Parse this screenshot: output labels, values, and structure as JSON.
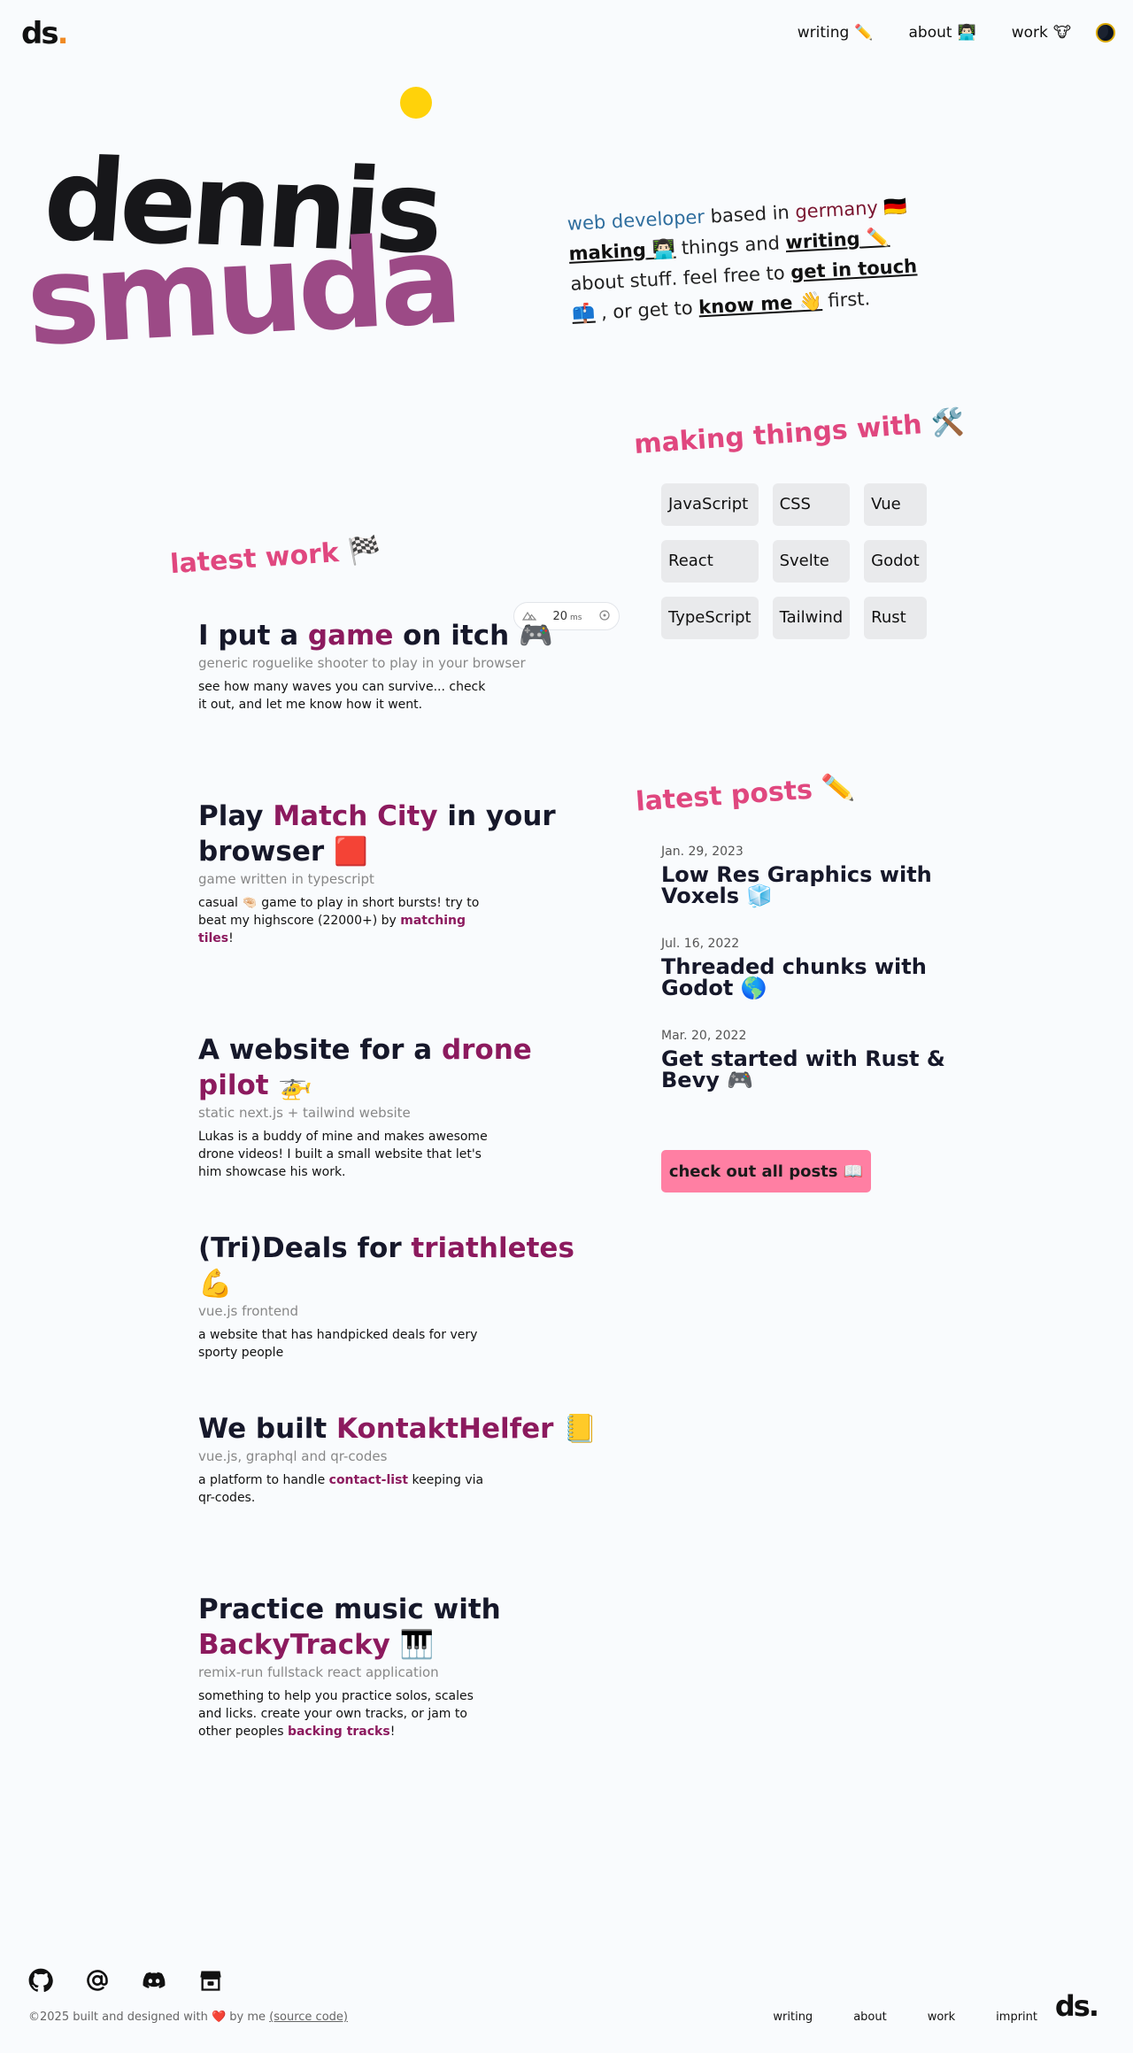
{
  "header": {
    "logo_text": "ds",
    "logo_dot": ".",
    "nav": [
      {
        "label": "writing",
        "emoji": "✏️"
      },
      {
        "label": "about",
        "emoji": "👨🏻‍💻"
      },
      {
        "label": "work",
        "emoji": "🐮"
      }
    ]
  },
  "hero": {
    "first_name": "dennis",
    "last_name": "smuda",
    "intro": {
      "role": "web developer",
      "t1": " based in ",
      "country": "germany",
      "flag": " 🇩🇪",
      "making": "making",
      "making_emoji": " 👨🏻‍💻",
      "t2": " things and ",
      "writing": "writing",
      "writing_emoji": " ✏️",
      "t3": " about stuff. feel free to ",
      "touch": "get in touch",
      "touch_emoji": " 📫",
      "t4": " , or get to ",
      "know": "know me",
      "know_emoji": " 👋",
      "t5": " first."
    }
  },
  "making": {
    "heading": "making things with 🛠️",
    "skills": [
      "JavaScript",
      "CSS",
      "Vue",
      "React",
      "Svelte",
      "Godot",
      "TypeScript",
      "Tailwind",
      "Rust"
    ]
  },
  "work": {
    "heading": "latest work 🏁",
    "perf_value": "20",
    "perf_unit": "ms",
    "projects": [
      {
        "pre": "I put a ",
        "hl": "game",
        "post": " on itch 🎮",
        "sub": "generic roguelike shooter to play in your browser",
        "desc_pre": "see how many waves you can survive... check it out, and let me know how it went.",
        "desc_hl": "",
        "desc_post": ""
      },
      {
        "pre": "Play ",
        "hl": "Match City",
        "post": " in your browser 🟥",
        "sub": "game written in typescript",
        "desc_pre": "casual 🤏🏻 game to play in short bursts! try to beat my highscore (22000+) by ",
        "desc_hl": "matching tiles",
        "desc_post": "!"
      },
      {
        "pre": "A website for a ",
        "hl": "drone pilot",
        "post": " 🚁",
        "sub": "static next.js + tailwind website",
        "desc_pre": "Lukas is a buddy of mine and makes awesome drone videos! I built a small website that let's him showcase his work.",
        "desc_hl": "",
        "desc_post": ""
      },
      {
        "pre": "(Tri)Deals for ",
        "hl": "triathletes",
        "post": " 💪",
        "sub": "vue.js frontend",
        "desc_pre": "a website that has handpicked deals for very sporty people",
        "desc_hl": "",
        "desc_post": ""
      },
      {
        "pre": "We built ",
        "hl": "KontaktHelfer",
        "post": " 📒",
        "sub": "vue.js, graphql and qr-codes",
        "desc_pre": "a platform to handle ",
        "desc_hl": "contact-list",
        "desc_post": " keeping via qr-codes."
      },
      {
        "pre": "Practice music with ",
        "hl": "BackyTracky",
        "post": " 🎹",
        "sub": "remix-run fullstack react application",
        "desc_pre": "something to help you practice solos, scales and licks. create your own tracks, or jam to other peoples ",
        "desc_hl": "backing tracks",
        "desc_post": "!"
      }
    ]
  },
  "posts": {
    "heading": "latest posts ✏️",
    "items": [
      {
        "date": "Jan. 29, 2023",
        "title": "Low Res Graphics with Voxels 🧊"
      },
      {
        "date": "Jul. 16, 2022",
        "title": "Threaded chunks with Godot 🌎"
      },
      {
        "date": "Mar. 20, 2022",
        "title": "Get started with Rust & Bevy 🎮"
      }
    ],
    "button": "check out all posts 📖"
  },
  "footer": {
    "icons": [
      "github-icon",
      "email-icon",
      "discord-icon",
      "store-icon"
    ],
    "copy_pre": "©2025 built and designed with ",
    "heart": "❤️",
    "copy_mid": " by me ",
    "source": "(source code)",
    "nav": [
      "writing",
      "about",
      "work",
      "imprint"
    ],
    "logo": "ds."
  }
}
